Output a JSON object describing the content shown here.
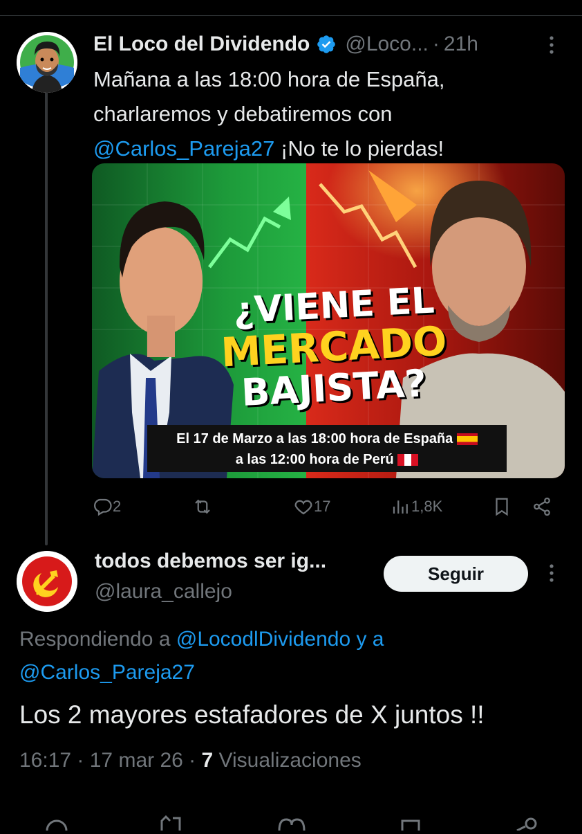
{
  "tweet": {
    "author_name": "El Loco del Dividendo",
    "author_handle": "@Loco...",
    "separator": "·",
    "time": "21h",
    "text_line1": "Mañana a las 18:00 hora de España,",
    "text_line2": "charlaremos y debatiremos con",
    "mention": "@Carlos_Pareja27",
    "text_after_mention": " ¡No te lo pierdas!",
    "media": {
      "headline_line1": "¿VIENE EL",
      "headline_line2": "MERCADO",
      "headline_line3": "BAJISTA?",
      "caption_line1": "El 17 de Marzo a las 18:00 hora de España",
      "caption_line2": "a las 12:00 hora de Perú"
    },
    "actions": {
      "replies": "2",
      "reposts": "",
      "likes": "17",
      "views": "1,8K"
    }
  },
  "reply": {
    "author_name": "todos debemos ser ig...",
    "author_handle": "@laura_callejo",
    "follow_label": "Seguir",
    "replying_prefix": "Respondiendo a ",
    "replying_user1": "@LocodlDividendo",
    "replying_and": " y a",
    "replying_user2": "@Carlos_Pareja27",
    "text": "Los 2 mayores estafadores de X juntos !!",
    "time": "16:17",
    "date": "17 mar 26",
    "views_count": "7",
    "views_label": "Visualizaciones"
  },
  "colors": {
    "accent": "#1d9bf0",
    "muted": "#71767b",
    "text": "#e7e9ea",
    "background": "#000000"
  }
}
